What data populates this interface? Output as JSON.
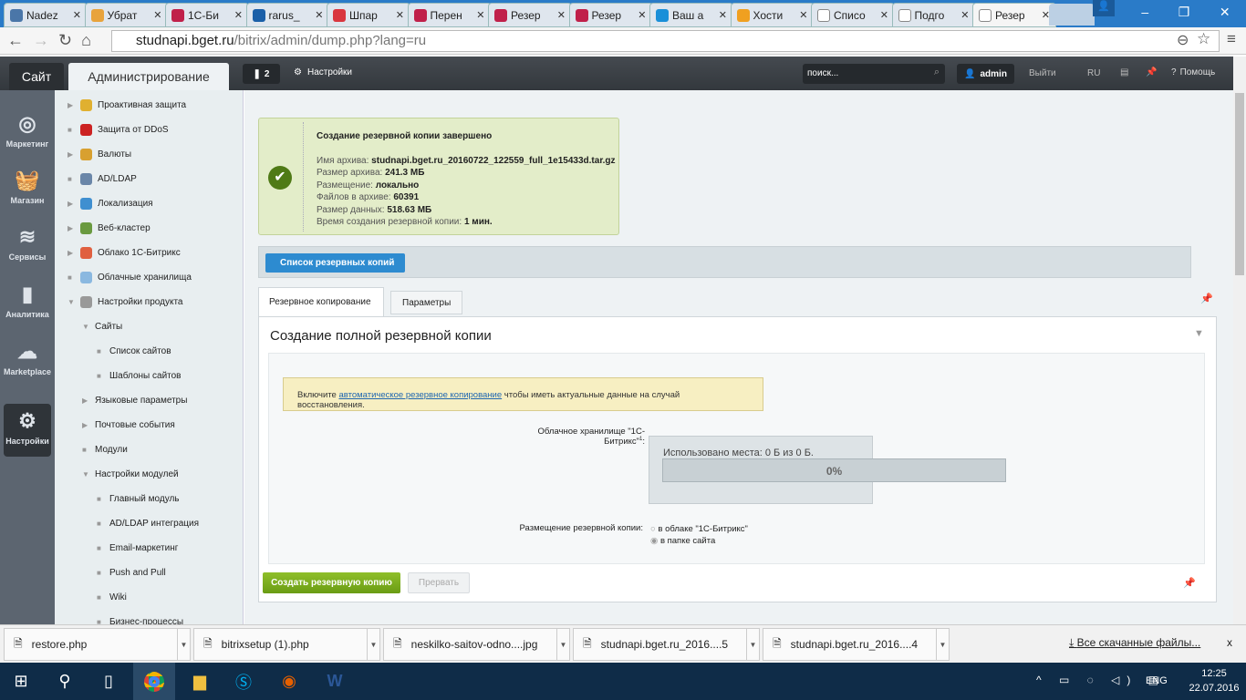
{
  "browser": {
    "tabs": [
      {
        "label": "Nadez",
        "color": "#4a76a8"
      },
      {
        "label": "Убрат",
        "color": "#e8a33c"
      },
      {
        "label": "1С-Би",
        "color": "#c0204a"
      },
      {
        "label": "rarus_",
        "color": "#1a5fa8"
      },
      {
        "label": "Шпар",
        "color": "#d9363e"
      },
      {
        "label": "Перен",
        "color": "#c0204a"
      },
      {
        "label": "Резер",
        "color": "#c0204a"
      },
      {
        "label": "Резер",
        "color": "#c0204a"
      },
      {
        "label": "Ваш а",
        "color": "#1a8fd8"
      },
      {
        "label": "Хости",
        "color": "#f0a020"
      },
      {
        "label": "Списо",
        "color": "#ffffff"
      },
      {
        "label": "Подго",
        "color": "#ffffff"
      },
      {
        "label": "Резер",
        "color": "#ffffff"
      }
    ],
    "url_host": "studnapi.bget.ru",
    "url_path": "/bitrix/admin/dump.php?lang=ru"
  },
  "header": {
    "site": "Сайт",
    "admin": "Администрирование",
    "notifications": "2",
    "settings": "Настройки",
    "search_placeholder": "поиск...",
    "user": "admin",
    "logout": "Выйти",
    "lang": "RU",
    "help": "Помощь"
  },
  "iconbar": [
    {
      "label": "Маркетинг",
      "icon": "◎"
    },
    {
      "label": "Магазин",
      "icon": "🧺"
    },
    {
      "label": "Сервисы",
      "icon": "≋"
    },
    {
      "label": "Аналитика",
      "icon": "▮"
    },
    {
      "label": "Marketplace",
      "icon": "☁"
    },
    {
      "label": "Настройки",
      "icon": "⚙"
    }
  ],
  "menu": [
    {
      "label": "Проактивная защита",
      "arrow": "▶",
      "indent": 0,
      "icon": "#e0b030"
    },
    {
      "label": "Защита от DDoS",
      "arrow": "■",
      "indent": 0,
      "icon": "#cc2222"
    },
    {
      "label": "Валюты",
      "arrow": "▶",
      "indent": 0,
      "icon": "#d8a030"
    },
    {
      "label": "AD/LDAP",
      "arrow": "■",
      "indent": 0,
      "icon": "#6a86a8"
    },
    {
      "label": "Локализация",
      "arrow": "▶",
      "indent": 0,
      "icon": "#3f8fd0"
    },
    {
      "label": "Веб-кластер",
      "arrow": "▶",
      "indent": 0,
      "icon": "#6a9a40"
    },
    {
      "label": "Облако 1С-Битрикс",
      "arrow": "▶",
      "indent": 0,
      "icon": "#e06040"
    },
    {
      "label": "Облачные хранилища",
      "arrow": "■",
      "indent": 0,
      "icon": "#8ab8e0"
    },
    {
      "label": "Настройки продукта",
      "arrow": "▼",
      "indent": 0,
      "icon": "#999999"
    },
    {
      "label": "Сайты",
      "arrow": "▼",
      "indent": 1
    },
    {
      "label": "Список сайтов",
      "arrow": "■",
      "indent": 2
    },
    {
      "label": "Шаблоны сайтов",
      "arrow": "■",
      "indent": 2
    },
    {
      "label": "Языковые параметры",
      "arrow": "▶",
      "indent": 1
    },
    {
      "label": "Почтовые события",
      "arrow": "▶",
      "indent": 1
    },
    {
      "label": "Модули",
      "arrow": "■",
      "indent": 1
    },
    {
      "label": "Настройки модулей",
      "arrow": "▼",
      "indent": 1
    },
    {
      "label": "Главный модуль",
      "arrow": "■",
      "indent": 2
    },
    {
      "label": "AD/LDAP интеграция",
      "arrow": "■",
      "indent": 2
    },
    {
      "label": "Email-маркетинг",
      "arrow": "■",
      "indent": 2
    },
    {
      "label": "Push and Pull",
      "arrow": "■",
      "indent": 2
    },
    {
      "label": "Wiki",
      "arrow": "■",
      "indent": 2
    },
    {
      "label": "Бизнес-процессы",
      "arrow": "■",
      "indent": 2
    }
  ],
  "success": {
    "title": "Создание резервной копии завершено",
    "rows": [
      {
        "label": "Имя архива: ",
        "value": "studnapi.bget.ru_20160722_122559_full_1e15433d.tar.gz"
      },
      {
        "label": "Размер архива: ",
        "value": "241.3 МБ"
      },
      {
        "label": "Размещение: ",
        "value": "локально"
      },
      {
        "label": "Файлов в архиве: ",
        "value": "60391"
      },
      {
        "label": "Размер данных: ",
        "value": "518.63 МБ"
      },
      {
        "label": "Время создания резервной копии: ",
        "value": "1 мин."
      }
    ]
  },
  "list_button": "Список резервных копий",
  "tabs": {
    "backup": "Резервное копирование",
    "params": "Параметры"
  },
  "section_title": "Создание полной резервной копии",
  "notice": {
    "before": "Включите ",
    "link": "автоматическое резервное копирование",
    "after": " чтобы иметь актуальные данные на случай восстановления."
  },
  "cloud": {
    "label": "Облачное хранилище \"1С-Битрикс\"",
    "sup": "1",
    "colon": ":",
    "used": "Использовано места: 0 Б из 0 Б.",
    "percent": "0%",
    "progress": 0
  },
  "placement": {
    "label": "Размещение резервной копии:",
    "options": [
      "в облаке \"1С-Битрикс\"",
      "в папке сайта"
    ],
    "selected": 1
  },
  "buttons": {
    "create": "Создать резервную копию",
    "abort": "Прервать"
  },
  "downloads": {
    "items": [
      "restore.php",
      "bitrixsetup (1).php",
      "neskilko-saitov-odno....jpg",
      "studnapi.bget.ru_2016....5",
      "studnapi.bget.ru_2016....4"
    ],
    "all": "Все скачанные файлы...",
    "close": "x"
  },
  "taskbar": {
    "lang": "ENG",
    "time": "12:25",
    "date": "22.07.2016"
  }
}
